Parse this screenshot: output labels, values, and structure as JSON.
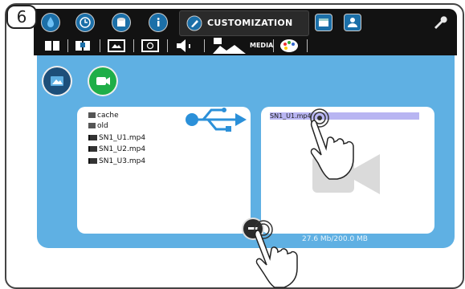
{
  "step_number": "6",
  "header": {
    "active_tab_label": "CUSTOMIZATION",
    "nav_icons": [
      "water-drop-icon",
      "clock-icon",
      "cylinder-icon",
      "info-icon",
      "customization-pen-icon",
      "calendar-icon",
      "user-icon",
      "wrench-icon"
    ]
  },
  "subtoolbar": {
    "icons": [
      "book-icon",
      "open-book-icon",
      "picture-icon",
      "screen-icon",
      "speaker-icon",
      "media-icon",
      "palette-icon"
    ],
    "media_label": "MEDIA"
  },
  "media": {
    "source_files": [
      "cache",
      "old",
      "SN1_U1.mp4",
      "SN1_U2.mp4",
      "SN1_U3.mp4"
    ],
    "selected_target_file": "SN1_U1.mp4",
    "storage_text": "27.6 Mb/200.0 MB"
  },
  "colors": {
    "panel_bg": "#5fb0e3",
    "toolbar_bg": "#121212",
    "image_button": "#1d4f7a",
    "video_button": "#1fae48",
    "selection": "#b8b5f2"
  }
}
